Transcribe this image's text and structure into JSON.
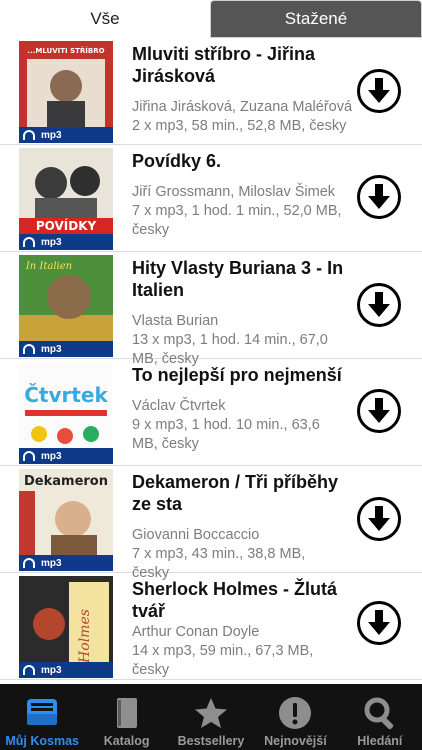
{
  "tabs": {
    "all_label": "Vše",
    "downloaded_label": "Stažené"
  },
  "cover_badge": "mp3",
  "items": [
    {
      "title": "Mluviti stříbro - Jiřina Jirásková",
      "authors": "Jiřina Jirásková, Zuzana Maléřová",
      "details": "2 x mp3, 58 min., 52,8 MB, česky",
      "cover_text": "...MLUVITI STŘÍBRO"
    },
    {
      "title": "Povídky 6.",
      "authors": "Jiří Grossmann, Miloslav Šimek",
      "details": "7 x mp3, 1 hod. 1 min., 52,0 MB, česky",
      "cover_text": "POVÍDKY"
    },
    {
      "title": "Hity Vlasty Buriana 3 - In Italien",
      "authors": "Vlasta Burian",
      "details": "13 x mp3, 1 hod. 14 min., 67,0 MB, česky",
      "cover_text": "In Italien"
    },
    {
      "title": "To nejlepší pro nejmenší",
      "authors": "Václav Čtvrtek",
      "details": "9 x mp3, 1 hod. 10 min., 63,6 MB, česky",
      "cover_text": "Čtvrtek"
    },
    {
      "title": "Dekameron / Tři příběhy ze sta",
      "authors": "Giovanni Boccaccio",
      "details": "7 x mp3, 43 min., 38,8 MB, česky",
      "cover_text": "Dekameron"
    },
    {
      "title": "Sherlock Holmes - Žlutá tvář",
      "authors": "Arthur Conan Doyle",
      "details": "14 x mp3, 59 min., 67,3 MB, česky",
      "cover_text": "Holmes"
    }
  ],
  "tabbar": [
    {
      "label": "Můj Kosmas",
      "icon": "inbox-tray-icon",
      "active": true
    },
    {
      "label": "Katalog",
      "icon": "book-icon",
      "active": false
    },
    {
      "label": "Bestsellery",
      "icon": "star-icon",
      "active": false
    },
    {
      "label": "Nejnovější",
      "icon": "exclamation-icon",
      "active": false
    },
    {
      "label": "Hledání",
      "icon": "search-icon",
      "active": false
    }
  ],
  "colors": {
    "accent": "#2f8df2",
    "tabbar_bg": "#121212",
    "inactive_tab_bg": "#555555",
    "badge_bg": "#0f3a8a",
    "meta_text": "#7d7d7d"
  }
}
